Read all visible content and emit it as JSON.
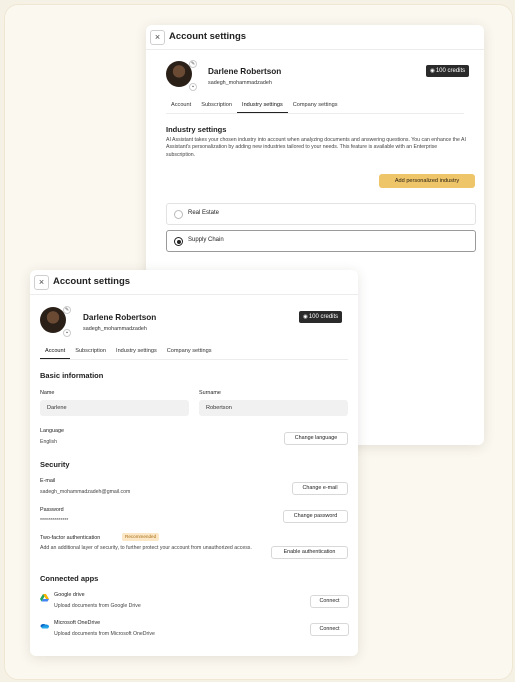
{
  "back_dialog": {
    "title": "Account settings",
    "close_label": "×",
    "user": {
      "name": "Darlene Robertson",
      "handle": "sadegh_mohammadzadeh"
    },
    "credits": "100 credits",
    "tabs": [
      "Account",
      "Subscription",
      "Industry settings",
      "Company settings"
    ],
    "active_tab": "Industry settings",
    "section_title": "Industry settings",
    "description": "AI Assistant takes your chosen industry into account when analyzing documents and answering questions. You can enhance the AI Assistant's personalization by adding new industries tailored to your needs. This feature is available with an Enterprise subscription.",
    "add_button": "Add personalized industry",
    "options": [
      {
        "label": "Real Estate",
        "selected": false
      },
      {
        "label": "Supply Chain",
        "selected": true
      }
    ]
  },
  "front_dialog": {
    "title": "Account settings",
    "close_label": "×",
    "user": {
      "name": "Darlene Robertson",
      "handle": "sadegh_mohammadzadeh"
    },
    "credits": "100 credits",
    "tabs": [
      "Account",
      "Subscription",
      "Industry settings",
      "Company settings"
    ],
    "active_tab": "Account",
    "basic_info": {
      "title": "Basic information",
      "name_label": "Name",
      "name_value": "Darlene",
      "surname_label": "Surname",
      "surname_value": "Robertson",
      "language_label": "Language",
      "language_value": "English",
      "change_language": "Change language"
    },
    "security": {
      "title": "Security",
      "email_label": "E-mail",
      "email_value": "sadegh_mohammadzadeh@gmail.com",
      "change_email": "Change e-mail",
      "password_label": "Password",
      "password_value": "**************",
      "change_password": "Change password",
      "tfa_label": "Two-factor authentication",
      "tfa_badge": "Recommended",
      "tfa_desc": "Add an additional layer of security, to further protect your account from unauthorized access.",
      "enable_auth": "Enable authentication"
    },
    "connected_apps": {
      "title": "Connected apps",
      "apps": [
        {
          "name": "Google drive",
          "desc": "Upload documents from Google Drive",
          "button": "Connect"
        },
        {
          "name": "Microsoft OneDrive",
          "desc": "Upload documents from Microsoft OneDrive",
          "button": "Connect"
        }
      ]
    }
  },
  "colors": {
    "accent": "#efc56a",
    "dark": "#2a2a2a",
    "badge_bg": "#fbe7c6",
    "badge_text": "#a86d14"
  },
  "icons": {
    "close": "close-icon",
    "edit": "pencil-icon",
    "delete": "trash-icon",
    "credits": "coins-icon",
    "google_drive": "google-drive-icon",
    "onedrive": "onedrive-icon"
  }
}
